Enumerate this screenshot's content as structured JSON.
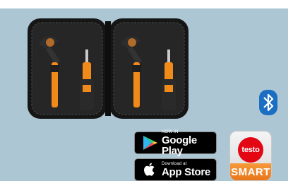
{
  "badges": {
    "google_play": {
      "small": "NOW IN",
      "big": "Google Play"
    },
    "app_store": {
      "small": "Download at",
      "big": "App Store"
    }
  },
  "app_icon": {
    "logo_text": "testo",
    "name": "SMART"
  },
  "icons": [
    "case-photo",
    "google-play-icon",
    "apple-icon",
    "bluetooth-icon",
    "testo-smart-app-icon"
  ],
  "colors": {
    "panel": "#adc6d4",
    "case": "#1c1c1c",
    "accent_orange": "#f08a1a",
    "bluetooth": "#1b6ec2",
    "testo_red": "#e30613"
  }
}
